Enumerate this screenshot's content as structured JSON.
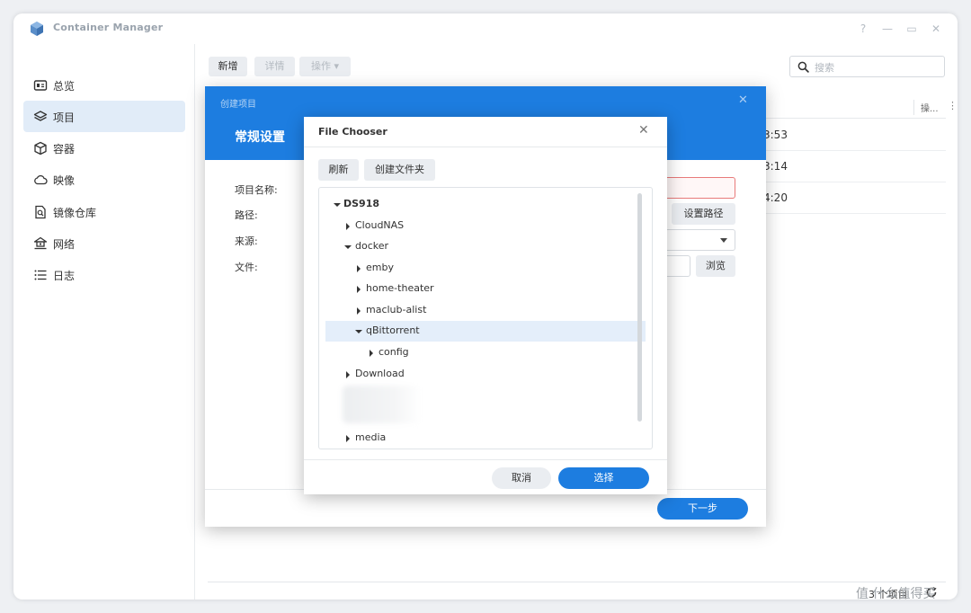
{
  "window": {
    "title": "Container Manager",
    "controls": {
      "help": "?",
      "minimize": "—",
      "maximize": "▭",
      "close": "✕"
    }
  },
  "sidebar": {
    "items": [
      {
        "label": "总览",
        "icon": "overview-icon",
        "active": false
      },
      {
        "label": "项目",
        "icon": "project-layers-icon",
        "active": true
      },
      {
        "label": "容器",
        "icon": "container-cube-icon",
        "active": false
      },
      {
        "label": "映像",
        "icon": "image-cloud-icon",
        "active": false
      },
      {
        "label": "镜像仓库",
        "icon": "registry-search-icon",
        "active": false
      },
      {
        "label": "网络",
        "icon": "network-icon",
        "active": false
      },
      {
        "label": "日志",
        "icon": "log-list-icon",
        "active": false
      }
    ]
  },
  "toolbar": {
    "new_label": "新增",
    "details_label": "详情",
    "actions_label": "操作 ▾",
    "search_placeholder": "搜索"
  },
  "grid": {
    "ops_header": "操...",
    "more_header": "⋮",
    "rows": [
      {
        "time_fragment": "3:53"
      },
      {
        "time_fragment": "3:14"
      },
      {
        "time_fragment": "4:20"
      }
    ],
    "count_label": "3 个项目"
  },
  "create_dialog": {
    "small_title": "创建项目",
    "close": "✕",
    "section_title": "常规设置",
    "fields": [
      {
        "label": "项目名称:"
      },
      {
        "label": "路径:",
        "button": "设置路径"
      },
      {
        "label": "来源:"
      },
      {
        "label": "文件:",
        "button": "浏览"
      }
    ],
    "next_label": "下一步"
  },
  "file_chooser": {
    "title": "File Chooser",
    "close": "✕",
    "refresh_label": "刷新",
    "new_folder_label": "创建文件夹",
    "tree": [
      {
        "label": "DS918",
        "depth": 0,
        "expanded": true
      },
      {
        "label": "CloudNAS",
        "depth": 1,
        "expanded": false
      },
      {
        "label": "docker",
        "depth": 1,
        "expanded": true
      },
      {
        "label": "emby",
        "depth": 2,
        "expanded": false
      },
      {
        "label": "home-theater",
        "depth": 2,
        "expanded": false
      },
      {
        "label": "maclub-alist",
        "depth": 2,
        "expanded": false
      },
      {
        "label": "qBittorrent",
        "depth": 2,
        "expanded": true,
        "selected": true
      },
      {
        "label": "config",
        "depth": 3,
        "expanded": false
      },
      {
        "label": "Download",
        "depth": 1,
        "expanded": false
      },
      {
        "label": "media",
        "depth": 1,
        "expanded": false
      }
    ],
    "cancel_label": "取消",
    "select_label": "选择"
  },
  "watermark": "值 什么值得买",
  "colors": {
    "accent": "#1d7de0",
    "active_nav_bg": "#e1ecf8",
    "selected_row_bg": "#e4eefa",
    "error_border": "#e87a7a"
  }
}
